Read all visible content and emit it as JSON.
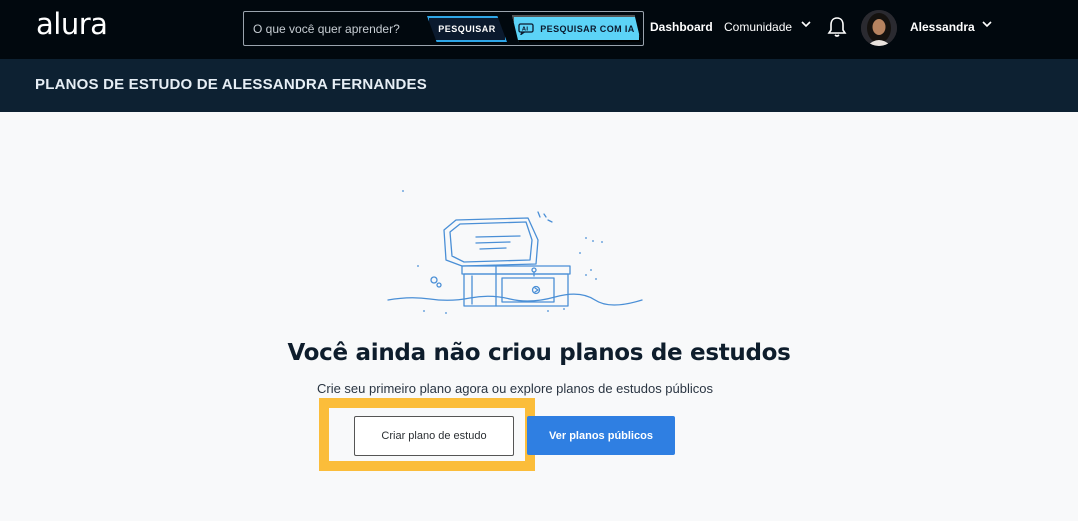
{
  "navbar": {
    "logo": "alura",
    "search": {
      "placeholder": "O que você quer aprender?",
      "button_label": "PESQUISAR",
      "ai_button_label": "PESQUISAR COM IA"
    },
    "links": {
      "dashboard": "Dashboard",
      "comunidade": "Comunidade"
    },
    "user": {
      "name": "Alessandra"
    }
  },
  "title_bar": {
    "title": "PLANOS DE ESTUDO DE ALESSANDRA FERNANDES"
  },
  "empty_state": {
    "illustration": "treasure-chest-illustration",
    "title": "Você ainda não criou planos de estudos",
    "subtitle": "Crie seu primeiro plano agora ou explore planos de estudos públicos",
    "create_button": "Criar plano de estudo",
    "public_button": "Ver planos públicos"
  },
  "colors": {
    "navbar_bg": "#01080e",
    "title_bar_bg": "#0d2132",
    "accent_cyan": "#5cd3f7",
    "primary_blue": "#2f7fe2",
    "highlight": "#fbbd3a"
  }
}
